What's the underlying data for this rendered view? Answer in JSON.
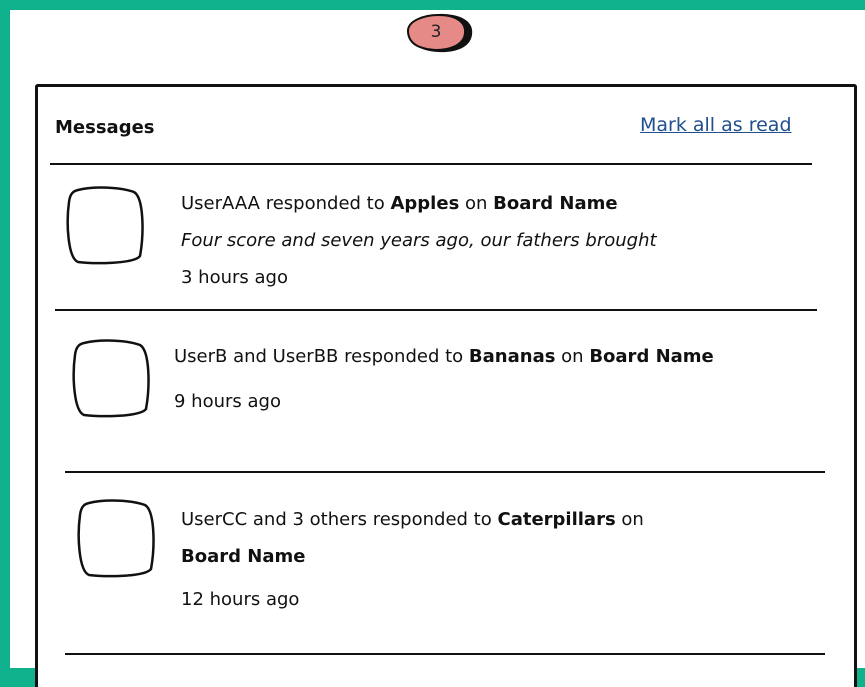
{
  "badge": {
    "count": "3"
  },
  "header": {
    "title": "Messages",
    "mark_all_label": "Mark all as read"
  },
  "notifications": [
    {
      "user": "UserAAA",
      "action": "responded to",
      "topic": "Apples",
      "on": "on",
      "board": "Board Name",
      "snippet": "Four score and seven years ago, our fathers brought",
      "time": "3 hours ago"
    },
    {
      "user": "UserB and UserBB",
      "action": "responded to",
      "topic": "Bananas",
      "on": "on",
      "board": "Board Name",
      "time": "9 hours ago"
    },
    {
      "user": "UserCC and 3 others",
      "action": "responded to",
      "topic": "Caterpillars",
      "on": "on",
      "board": "Board Name",
      "time": "12 hours ago"
    }
  ]
}
